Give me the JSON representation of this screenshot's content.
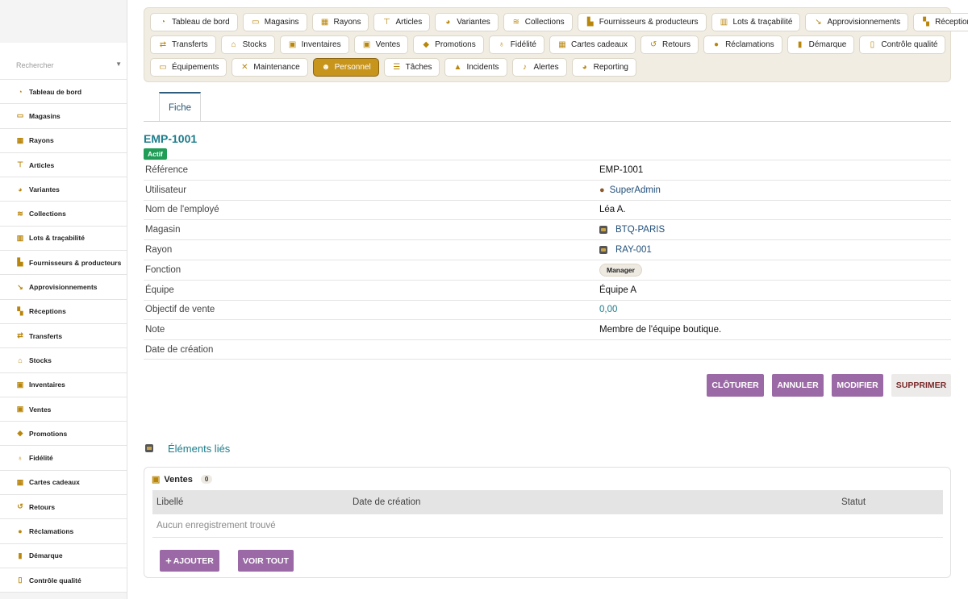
{
  "sidebar": {
    "search_placeholder": "Rechercher",
    "items": [
      {
        "label": "Tableau de bord",
        "icon": "gauge-icon"
      },
      {
        "label": "Magasins",
        "icon": "store-icon"
      },
      {
        "label": "Rayons",
        "icon": "grid-icon"
      },
      {
        "label": "Articles",
        "icon": "shirt-icon"
      },
      {
        "label": "Variantes",
        "icon": "palette-icon"
      },
      {
        "label": "Collections",
        "icon": "layers-icon"
      },
      {
        "label": "Lots & traçabilité",
        "icon": "barcode-icon"
      },
      {
        "label": "Fournisseurs & producteurs",
        "icon": "industry-icon"
      },
      {
        "label": "Approvisionnements",
        "icon": "dolly-icon"
      },
      {
        "label": "Réceptions",
        "icon": "truck-loading-icon"
      },
      {
        "label": "Transferts",
        "icon": "exchange-icon"
      },
      {
        "label": "Stocks",
        "icon": "warehouse-icon"
      },
      {
        "label": "Inventaires",
        "icon": "clipboard-check-icon"
      },
      {
        "label": "Ventes",
        "icon": "cash-register-icon"
      },
      {
        "label": "Promotions",
        "icon": "tags-icon"
      },
      {
        "label": "Fidélité",
        "icon": "award-icon"
      },
      {
        "label": "Cartes cadeaux",
        "icon": "gift-icon"
      },
      {
        "label": "Retours",
        "icon": "undo-icon"
      },
      {
        "label": "Réclamations",
        "icon": "comment-icon"
      },
      {
        "label": "Démarque",
        "icon": "trash-icon"
      },
      {
        "label": "Contrôle qualité",
        "icon": "clipboard-icon"
      }
    ]
  },
  "tabs": {
    "row1": [
      {
        "label": "Tableau de bord",
        "icon": "gauge-icon"
      },
      {
        "label": "Magasins",
        "icon": "store-icon"
      },
      {
        "label": "Rayons",
        "icon": "grid-icon"
      },
      {
        "label": "Articles",
        "icon": "shirt-icon"
      },
      {
        "label": "Variantes",
        "icon": "palette-icon"
      },
      {
        "label": "Collections",
        "icon": "layers-icon"
      },
      {
        "label": "Fournisseurs & producteurs",
        "icon": "industry-icon"
      },
      {
        "label": "Lots & traçabilité",
        "icon": "barcode-icon"
      },
      {
        "label": "Approvisionnements",
        "icon": "dolly-icon"
      },
      {
        "label": "Réceptions",
        "icon": "truck-loading-icon"
      }
    ],
    "row2": [
      {
        "label": "Transferts",
        "icon": "exchange-icon"
      },
      {
        "label": "Stocks",
        "icon": "warehouse-icon"
      },
      {
        "label": "Inventaires",
        "icon": "clipboard-check-icon"
      },
      {
        "label": "Ventes",
        "icon": "cash-register-icon"
      },
      {
        "label": "Promotions",
        "icon": "tags-icon"
      },
      {
        "label": "Fidélité",
        "icon": "award-icon"
      },
      {
        "label": "Cartes cadeaux",
        "icon": "gift-icon"
      },
      {
        "label": "Retours",
        "icon": "undo-icon"
      },
      {
        "label": "Réclamations",
        "icon": "comment-icon"
      },
      {
        "label": "Démarque",
        "icon": "trash-icon"
      },
      {
        "label": "Contrôle qualité",
        "icon": "clipboard-icon"
      }
    ],
    "row3": [
      {
        "label": "Équipements",
        "icon": "monitor-icon"
      },
      {
        "label": "Maintenance",
        "icon": "tools-icon"
      },
      {
        "label": "Personnel",
        "icon": "users-icon",
        "active": true
      },
      {
        "label": "Tâches",
        "icon": "list-icon"
      },
      {
        "label": "Incidents",
        "icon": "warning-icon"
      },
      {
        "label": "Alertes",
        "icon": "bell-icon"
      },
      {
        "label": "Reporting",
        "icon": "pie-chart-icon"
      }
    ]
  },
  "subtab": {
    "label": "Fiche"
  },
  "record": {
    "title": "EMP-1001",
    "status": "Actif",
    "fields": [
      {
        "label": "Référence",
        "value": "EMP-1001",
        "kind": "text"
      },
      {
        "label": "Utilisateur",
        "value": "SuperAdmin",
        "kind": "user-link"
      },
      {
        "label": "Nom de l'employé",
        "value": "Léa A.",
        "kind": "text"
      },
      {
        "label": "Magasin",
        "value": "BTQ-PARIS",
        "kind": "store-link"
      },
      {
        "label": "Rayon",
        "value": "RAY-001",
        "kind": "store-link"
      },
      {
        "label": "Fonction",
        "value": "Manager",
        "kind": "chip"
      },
      {
        "label": "Équipe",
        "value": "Équipe A",
        "kind": "text"
      },
      {
        "label": "Objectif de vente",
        "value": "0,00",
        "kind": "number"
      },
      {
        "label": "Note",
        "value": "Membre de l'équipe boutique.",
        "kind": "text"
      },
      {
        "label": "Date de création",
        "value": "",
        "kind": "text"
      }
    ]
  },
  "actions": {
    "close": "CLÔTURER",
    "cancel": "ANNULER",
    "edit": "MODIFIER",
    "delete": "SUPPRIMER"
  },
  "related": {
    "title": "Éléments liés",
    "sales": {
      "title": "Ventes",
      "count": "0",
      "columns": [
        "Libellé",
        "Date de création",
        "Statut"
      ],
      "empty_text": "Aucun enregistrement trouvé",
      "add_label": "AJOUTER",
      "add_symbol": "+",
      "view_all_label": "VOIR TOUT"
    }
  },
  "colors": {
    "accent": "#c7941c",
    "action_purple": "#9b6aa6",
    "title_teal": "#1d7c8a",
    "status_green": "#1f9d57"
  }
}
